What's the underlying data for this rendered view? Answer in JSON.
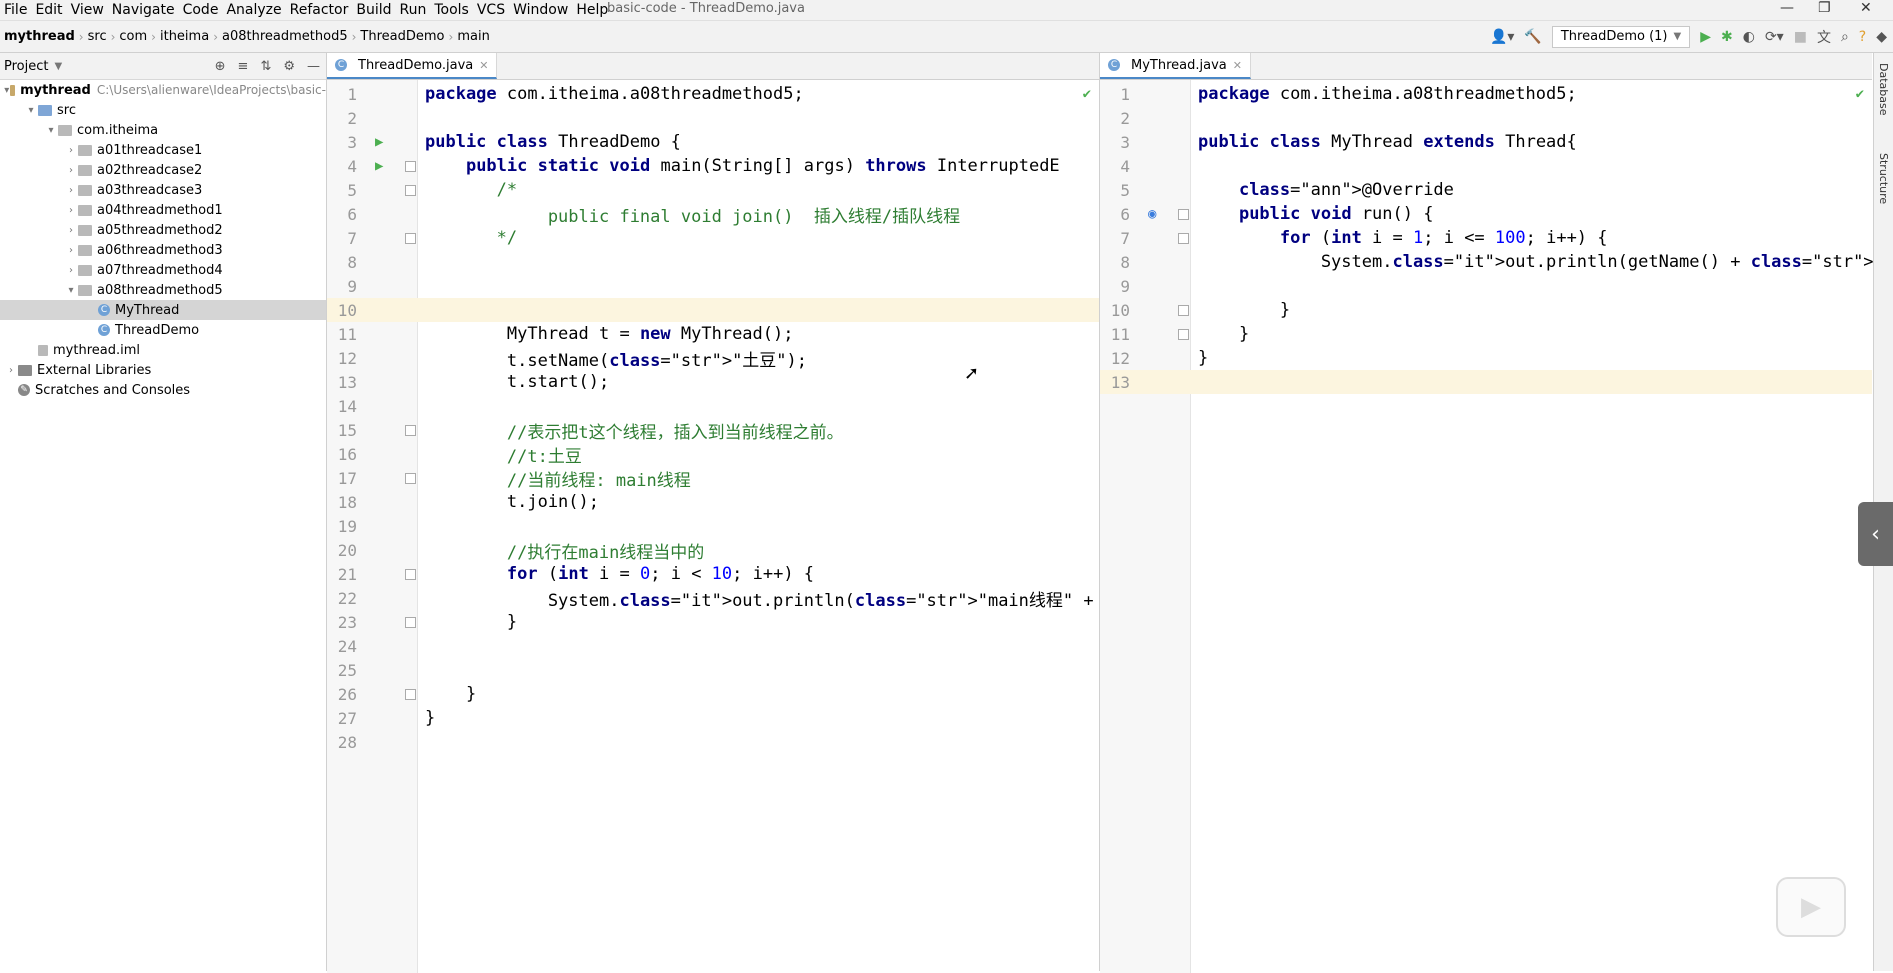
{
  "window": {
    "title": "basic-code - ThreadDemo.java",
    "menus": [
      "File",
      "Edit",
      "View",
      "Navigate",
      "Code",
      "Analyze",
      "Refactor",
      "Build",
      "Run",
      "Tools",
      "VCS",
      "Window",
      "Help"
    ]
  },
  "breadcrumb": [
    "mythread",
    "src",
    "com",
    "itheima",
    "a08threadmethod5",
    "ThreadDemo",
    "main"
  ],
  "run_config": "ThreadDemo (1)",
  "project_panel": {
    "title": "Project",
    "tree": [
      {
        "label": "mythread",
        "extra": "C:\\Users\\alienware\\IdeaProjects\\basic-",
        "depth": 0,
        "arrow": "▾",
        "icon": "folder"
      },
      {
        "label": "src",
        "depth": 1,
        "arrow": "▾",
        "icon": "src"
      },
      {
        "label": "com.itheima",
        "depth": 2,
        "arrow": "▾",
        "icon": "pkg"
      },
      {
        "label": "a01threadcase1",
        "depth": 3,
        "arrow": "›",
        "icon": "pkg"
      },
      {
        "label": "a02threadcase2",
        "depth": 3,
        "arrow": "›",
        "icon": "pkg"
      },
      {
        "label": "a03threadcase3",
        "depth": 3,
        "arrow": "›",
        "icon": "pkg"
      },
      {
        "label": "a04threadmethod1",
        "depth": 3,
        "arrow": "›",
        "icon": "pkg"
      },
      {
        "label": "a05threadmethod2",
        "depth": 3,
        "arrow": "›",
        "icon": "pkg"
      },
      {
        "label": "a06threadmethod3",
        "depth": 3,
        "arrow": "›",
        "icon": "pkg"
      },
      {
        "label": "a07threadmethod4",
        "depth": 3,
        "arrow": "›",
        "icon": "pkg"
      },
      {
        "label": "a08threadmethod5",
        "depth": 3,
        "arrow": "▾",
        "icon": "pkg"
      },
      {
        "label": "MyThread",
        "depth": 4,
        "arrow": "",
        "icon": "class",
        "selected": true
      },
      {
        "label": "ThreadDemo",
        "depth": 4,
        "arrow": "",
        "icon": "class"
      },
      {
        "label": "mythread.iml",
        "depth": 1,
        "arrow": "",
        "icon": "file"
      },
      {
        "label": "External Libraries",
        "depth": 0,
        "arrow": "›",
        "icon": "lib"
      },
      {
        "label": "Scratches and Consoles",
        "depth": 0,
        "arrow": "",
        "icon": "scratch"
      }
    ]
  },
  "left_editor": {
    "tab": "ThreadDemo.java",
    "lines": [
      "package com.itheima.a08threadmethod5;",
      "",
      "public class ThreadDemo {",
      "    public static void main(String[] args) throws InterruptedE",
      "       /*",
      "            public final void join()  插入线程/插队线程",
      "       */",
      "",
      "",
      "",
      "        MyThread t = new MyThread();",
      "        t.setName(\"土豆\");",
      "        t.start();",
      "",
      "        //表示把t这个线程，插入到当前线程之前。",
      "        //t:土豆",
      "        //当前线程: main线程",
      "        t.join();",
      "",
      "        //执行在main线程当中的",
      "        for (int i = 0; i < 10; i++) {",
      "            System.out.println(\"main线程\" + i);",
      "        }",
      "",
      "",
      "    }",
      "}",
      ""
    ]
  },
  "right_editor": {
    "tab": "MyThread.java",
    "lines": [
      "package com.itheima.a08threadmethod5;",
      "",
      "public class MyThread extends Thread{",
      "",
      "    @Override",
      "    public void run() {",
      "        for (int i = 1; i <= 100; i++) {",
      "            System.out.println(getName() + \"@\" + i);",
      "",
      "        }",
      "    }",
      "}",
      ""
    ]
  },
  "side_tabs": [
    "Database",
    "Structure"
  ]
}
